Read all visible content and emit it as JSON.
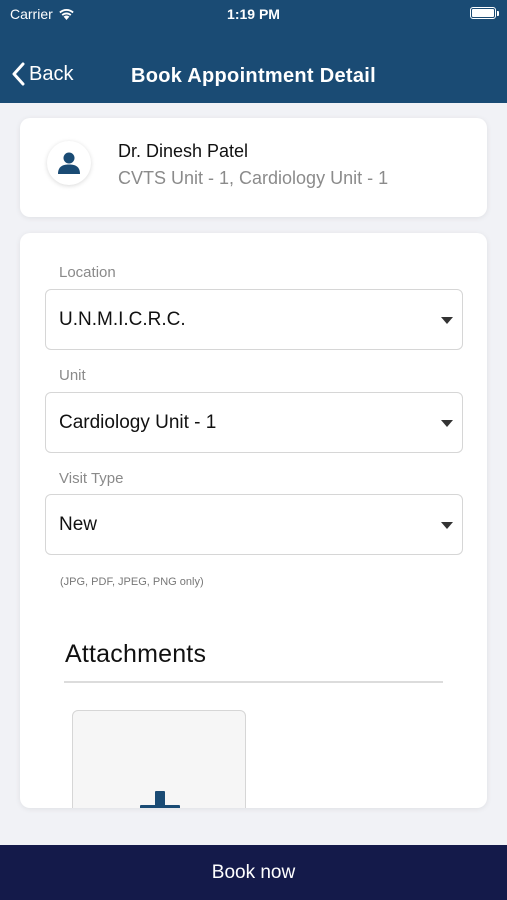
{
  "status_bar": {
    "carrier": "Carrier",
    "time": "1:19 PM"
  },
  "nav": {
    "back_label": "Back",
    "title": "Book Appointment Detail"
  },
  "doctor": {
    "name": "Dr. Dinesh Patel",
    "units": "CVTS Unit - 1, Cardiology Unit - 1",
    "avatar_icon": "user-icon"
  },
  "form": {
    "location": {
      "label": "Location",
      "value": "U.N.M.I.C.R.C."
    },
    "unit": {
      "label": "Unit",
      "value": "Cardiology Unit - 1"
    },
    "visit_type": {
      "label": "Visit Type",
      "value": "New"
    },
    "file_note": "(JPG, PDF, JPEG, PNG only)",
    "attachments_title": "Attachments"
  },
  "footer": {
    "book_label": "Book now"
  },
  "colors": {
    "header": "#1a4b74",
    "footer": "#141a4a",
    "background": "#f1f2f6"
  }
}
